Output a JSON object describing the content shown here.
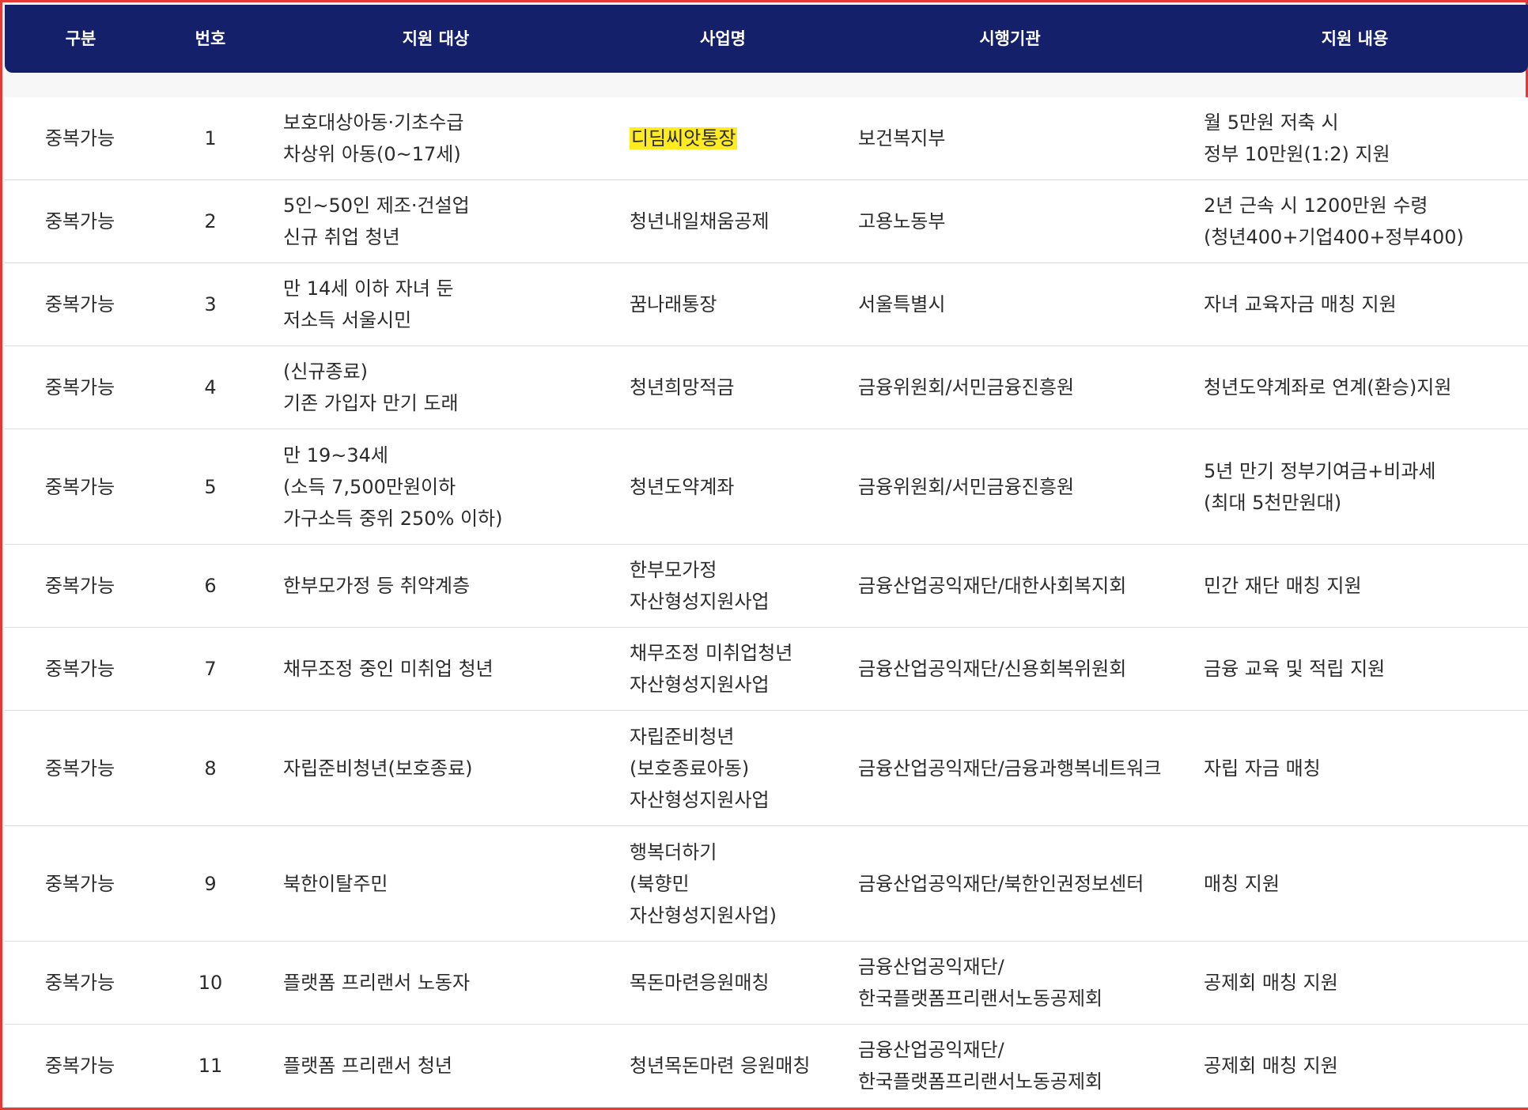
{
  "header": {
    "columns": [
      "구분",
      "번호",
      "지원 대상",
      "사업명",
      "시행기관",
      "지원 내용"
    ]
  },
  "rows": [
    {
      "category": "중복가능",
      "number": "1",
      "target": [
        "보호대상아동·기초수급",
        "차상위 아동(0~17세)"
      ],
      "program": [
        "디딤씨앗통장"
      ],
      "program_highlight": true,
      "agency": [
        "보건복지부"
      ],
      "support": [
        "월 5만원 저축 시",
        "정부 10만원(1:2) 지원"
      ]
    },
    {
      "category": "중복가능",
      "number": "2",
      "target": [
        "5인~50인 제조·건설업",
        "신규 취업 청년"
      ],
      "program": [
        "청년내일채움공제"
      ],
      "agency": [
        "고용노동부"
      ],
      "support": [
        "2년 근속 시 1200만원 수령",
        "(청년400+기업400+정부400)"
      ]
    },
    {
      "category": "중복가능",
      "number": "3",
      "target": [
        "만 14세 이하 자녀 둔",
        "저소득 서울시민"
      ],
      "program": [
        "꿈나래통장"
      ],
      "agency": [
        "서울특별시"
      ],
      "support": [
        "자녀 교육자금 매칭 지원"
      ]
    },
    {
      "category": "중복가능",
      "number": "4",
      "target": [
        "(신규종료)",
        "기존 가입자 만기 도래"
      ],
      "program": [
        "청년희망적금"
      ],
      "agency": [
        "금융위원회/서민금융진흥원"
      ],
      "support": [
        "청년도약계좌로 연계(환승)지원"
      ]
    },
    {
      "category": "중복가능",
      "number": "5",
      "target": [
        "만 19~34세",
        "(소득 7,500만원이하",
        "가구소득 중위 250% 이하)"
      ],
      "program": [
        "청년도약계좌"
      ],
      "agency": [
        "금융위원회/서민금융진흥원"
      ],
      "support": [
        "5년 만기 정부기여금+비과세",
        "(최대 5천만원대)"
      ]
    },
    {
      "category": "중복가능",
      "number": "6",
      "target": [
        "한부모가정 등 취약계층"
      ],
      "program": [
        "한부모가정",
        "자산형성지원사업"
      ],
      "agency": [
        "금융산업공익재단/대한사회복지회"
      ],
      "support": [
        "민간 재단 매칭 지원"
      ]
    },
    {
      "category": "중복가능",
      "number": "7",
      "target": [
        "채무조정 중인 미취업 청년"
      ],
      "program": [
        "채무조정 미취업청년",
        "자산형성지원사업"
      ],
      "agency": [
        "금융산업공익재단/신용회복위원회"
      ],
      "support": [
        "금융 교육 및 적립 지원"
      ]
    },
    {
      "category": "중복가능",
      "number": "8",
      "target": [
        "자립준비청년(보호종료)"
      ],
      "program": [
        "자립준비청년",
        "(보호종료아동)",
        "자산형성지원사업"
      ],
      "agency": [
        "금융산업공익재단/금융과행복네트워크"
      ],
      "support": [
        "자립 자금 매칭"
      ]
    },
    {
      "category": "중복가능",
      "number": "9",
      "target": [
        "북한이탈주민"
      ],
      "program": [
        "행복더하기",
        "(북향민",
        "자산형성지원사업)"
      ],
      "agency": [
        "금융산업공익재단/북한인권정보센터"
      ],
      "support": [
        "매칭 지원"
      ]
    },
    {
      "category": "중복가능",
      "number": "10",
      "target": [
        "플랫폼 프리랜서 노동자"
      ],
      "program": [
        "목돈마련응원매칭"
      ],
      "agency": [
        "금융산업공익재단/",
        "한국플랫폼프리랜서노동공제회"
      ],
      "support": [
        "공제회 매칭 지원"
      ]
    },
    {
      "category": "중복가능",
      "number": "11",
      "target": [
        "플랫폼 프리랜서 청년"
      ],
      "program": [
        "청년목돈마련 응원매칭"
      ],
      "agency": [
        "금융산업공익재단/",
        "한국플랫폼프리랜서노동공제회"
      ],
      "support": [
        "공제회 매칭 지원"
      ]
    }
  ]
}
